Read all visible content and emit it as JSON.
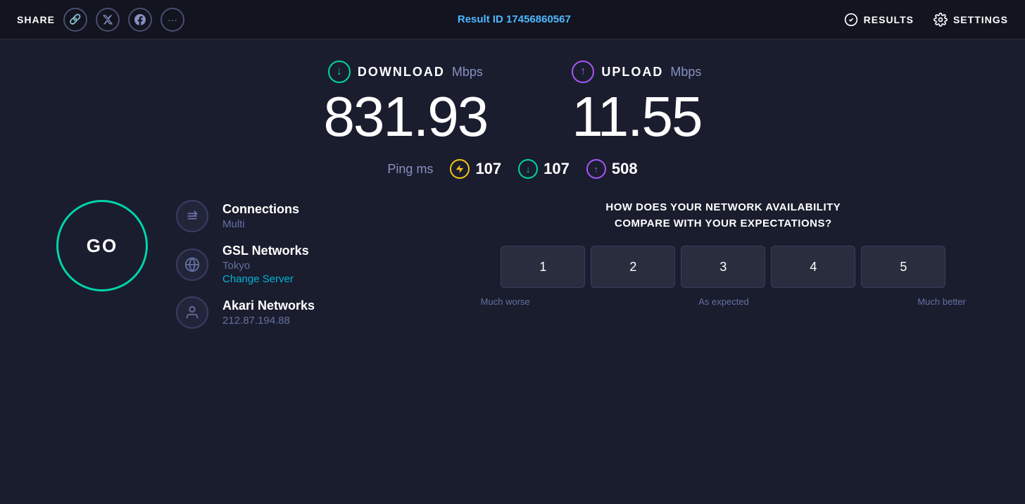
{
  "header": {
    "share_label": "SHARE",
    "result_prefix": "Result ID",
    "result_id": "17456860567",
    "results_label": "RESULTS",
    "settings_label": "SETTINGS"
  },
  "social": {
    "link_icon": "🔗",
    "twitter_icon": "𝕏",
    "facebook_icon": "f",
    "more_icon": "···"
  },
  "download": {
    "label": "DOWNLOAD",
    "unit": "Mbps",
    "value": "831.93"
  },
  "upload": {
    "label": "UPLOAD",
    "unit": "Mbps",
    "value": "11.55"
  },
  "ping": {
    "label": "Ping",
    "unit": "ms",
    "jitter": "107",
    "download_ping": "107",
    "upload_ping": "508"
  },
  "connections": {
    "label": "Connections",
    "value": "Multi"
  },
  "server": {
    "label": "GSL Networks",
    "location": "Tokyo",
    "change_label": "Change Server"
  },
  "isp": {
    "label": "Akari Networks",
    "ip": "212.87.194.88"
  },
  "go_button": "GO",
  "survey": {
    "question": "HOW DOES YOUR NETWORK AVAILABILITY\nCOMPARE WITH YOUR EXPECTATIONS?",
    "options": [
      "1",
      "2",
      "3",
      "4",
      "5"
    ],
    "label_left": "Much worse",
    "label_center": "As expected",
    "label_right": "Much better"
  }
}
